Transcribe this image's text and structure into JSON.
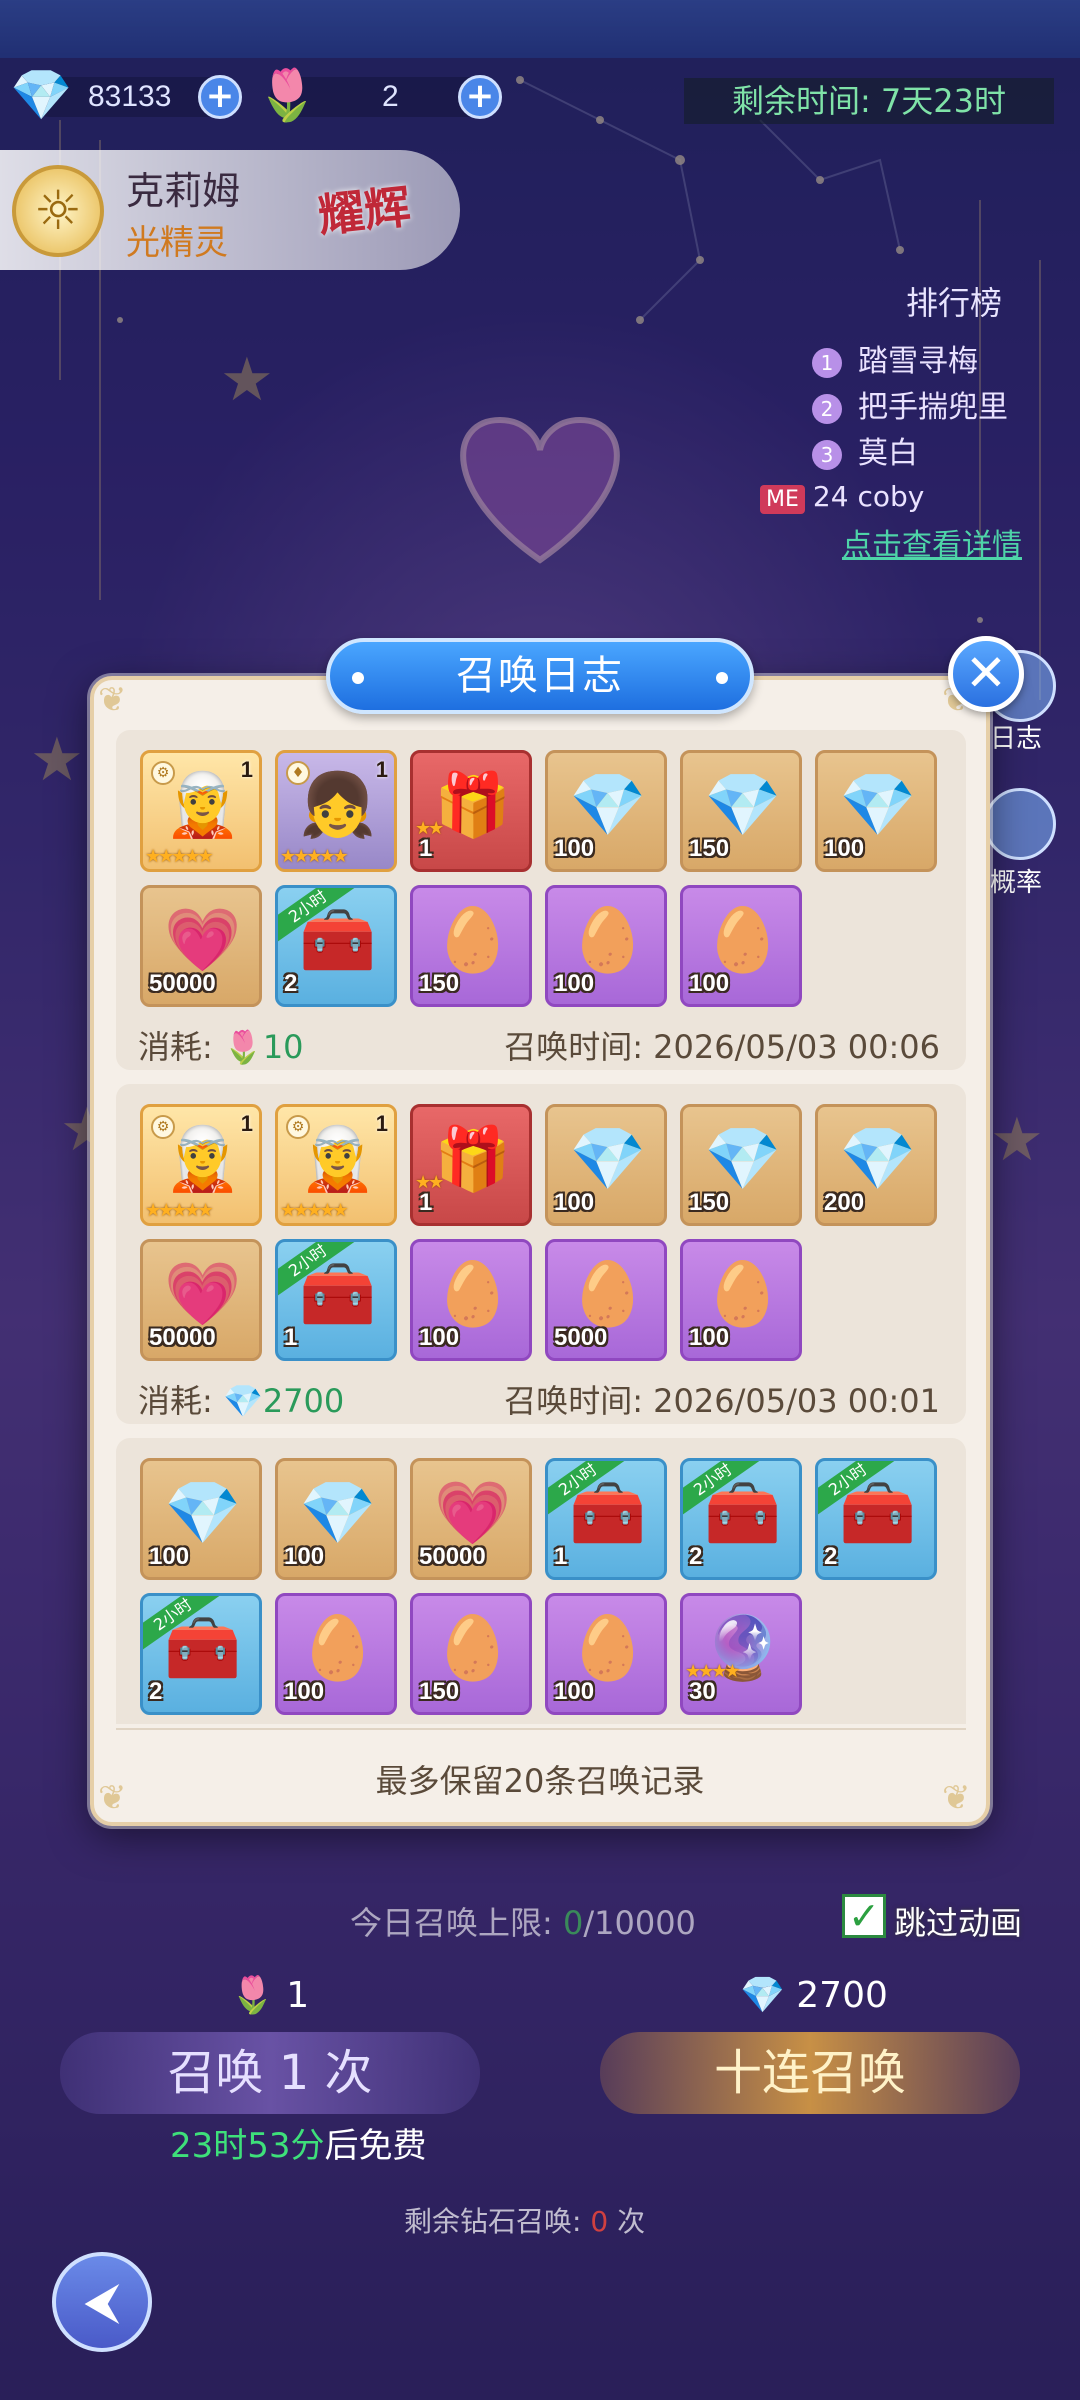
{
  "currency": {
    "diamonds": "83133",
    "tulips": "2",
    "timer_label": "剩余时间: 7天23时"
  },
  "hero": {
    "name": "克莉姆",
    "type": "光精灵",
    "badge": "耀辉"
  },
  "ranking": {
    "title": "排行榜",
    "items": [
      "踏雪寻梅",
      "把手揣兜里",
      "莫白"
    ],
    "me_rank": "24",
    "me_name": "coby",
    "detail_link": "点击查看详情"
  },
  "side": {
    "log_label": "日志",
    "rate_label": "概率"
  },
  "modal": {
    "title": "召唤日志",
    "footer": "最多保留20条召唤记录",
    "cost_label": "消耗:",
    "time_label": "召唤时间:",
    "entries": [
      {
        "cost": "10",
        "cost_icon": "tulip-icon",
        "time": "2026/05/03 00:06",
        "items": [
          {
            "kind": "char1",
            "art": "🧝",
            "tr": "1",
            "stars": "★★★★★",
            "seal": "⚙"
          },
          {
            "kind": "char2",
            "art": "👧",
            "tr": "1",
            "stars": "★★★★★",
            "seal": "♦"
          },
          {
            "kind": "red",
            "art": "🎁",
            "count": "1",
            "stars": "★★"
          },
          {
            "kind": "gold",
            "art": "💎",
            "count": "100"
          },
          {
            "kind": "gold",
            "art": "💎",
            "count": "150"
          },
          {
            "kind": "gold",
            "art": "💎",
            "count": "100"
          },
          {
            "kind": "gold",
            "art": "💗",
            "count": "50000"
          },
          {
            "kind": "blue",
            "art": "🧰",
            "count": "2",
            "ribbon": "2小时"
          },
          {
            "kind": "purple",
            "art": "🥚",
            "count": "150"
          },
          {
            "kind": "purple",
            "art": "🥚",
            "count": "100"
          },
          {
            "kind": "purple",
            "art": "🥚",
            "count": "100"
          }
        ]
      },
      {
        "cost": "2700",
        "cost_icon": "diamond-icon",
        "time": "2026/05/03 00:01",
        "items": [
          {
            "kind": "char1",
            "art": "🧝",
            "tr": "1",
            "stars": "★★★★★",
            "seal": "⚙"
          },
          {
            "kind": "char1",
            "art": "🧝",
            "tr": "1",
            "stars": "★★★★★",
            "seal": "⚙"
          },
          {
            "kind": "red",
            "art": "🎁",
            "count": "1",
            "stars": "★★"
          },
          {
            "kind": "gold",
            "art": "💎",
            "count": "100"
          },
          {
            "kind": "gold",
            "art": "💎",
            "count": "150"
          },
          {
            "kind": "gold",
            "art": "💎",
            "count": "200"
          },
          {
            "kind": "gold",
            "art": "💗",
            "count": "50000"
          },
          {
            "kind": "blue",
            "art": "🧰",
            "count": "1",
            "ribbon": "2小时"
          },
          {
            "kind": "purple",
            "art": "🥚",
            "count": "100"
          },
          {
            "kind": "purple",
            "art": "🥚",
            "count": "5000"
          },
          {
            "kind": "purple",
            "art": "🥚",
            "count": "100"
          }
        ]
      },
      {
        "items": [
          {
            "kind": "gold",
            "art": "💎",
            "count": "100"
          },
          {
            "kind": "gold",
            "art": "💎",
            "count": "100"
          },
          {
            "kind": "gold",
            "art": "💗",
            "count": "50000"
          },
          {
            "kind": "blue",
            "art": "🧰",
            "count": "1",
            "ribbon": "2小时"
          },
          {
            "kind": "blue",
            "art": "🧰",
            "count": "2",
            "ribbon": "2小时"
          },
          {
            "kind": "blue",
            "art": "🧰",
            "count": "2",
            "ribbon": "2小时"
          },
          {
            "kind": "blue",
            "art": "🧰",
            "count": "2",
            "ribbon": "2小时"
          },
          {
            "kind": "purple",
            "art": "🥚",
            "count": "100"
          },
          {
            "kind": "purple",
            "art": "🥚",
            "count": "150"
          },
          {
            "kind": "purple",
            "art": "🥚",
            "count": "100"
          },
          {
            "kind": "purple",
            "art": "🔮",
            "count": "30",
            "stars": "★★★★"
          }
        ]
      }
    ]
  },
  "bottom": {
    "limit_label": "今日召唤上限:",
    "limit_value": "/10000",
    "skip_label": "跳过动画",
    "tulip_count": "1",
    "diamond_count": "2700",
    "summon_one": "召唤 1 次",
    "summon_ten": "十连召唤",
    "free_time": "23时53分",
    "free_suffix": "后免费",
    "diamond_remaining_prefix": "剩余钻石召唤:",
    "diamond_remaining_suffix": "次"
  }
}
